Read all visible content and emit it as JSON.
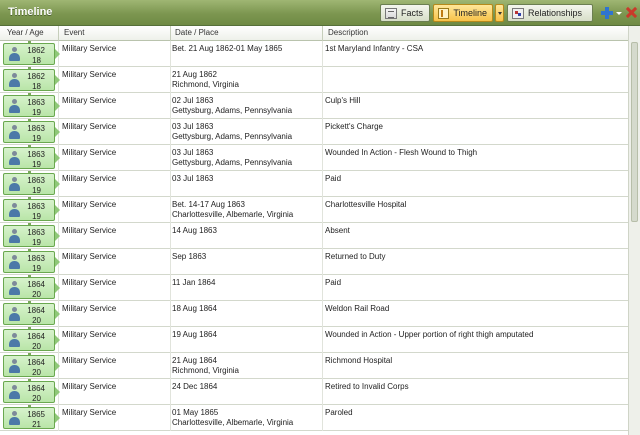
{
  "header": {
    "title": "Timeline",
    "buttons": {
      "facts": "Facts",
      "timeline": "Timeline",
      "relationships": "Relationships"
    }
  },
  "columns": [
    "Year / Age",
    "Event",
    "Date / Place",
    "Description"
  ],
  "rows": [
    {
      "year": "1862",
      "age": "18",
      "event": "Military Service",
      "date": "Bet. 21 Aug 1862-01 May 1865",
      "place": "",
      "description": "1st Maryland Infantry - CSA"
    },
    {
      "year": "1862",
      "age": "18",
      "event": "Military Service",
      "date": "21 Aug 1862",
      "place": "Richmond, Virginia",
      "description": ""
    },
    {
      "year": "1863",
      "age": "19",
      "event": "Military Service",
      "date": "02 Jul 1863",
      "place": "Gettysburg, Adams, Pennsylvania",
      "description": "Culp's Hill"
    },
    {
      "year": "1863",
      "age": "19",
      "event": "Military Service",
      "date": "03 Jul 1863",
      "place": "Gettysburg, Adams, Pennsylvania",
      "description": "Pickett's Charge"
    },
    {
      "year": "1863",
      "age": "19",
      "event": "Military Service",
      "date": "03 Jul 1863",
      "place": "Gettysburg, Adams, Pennsylvania",
      "description": "Wounded In Action - Flesh Wound to Thigh"
    },
    {
      "year": "1863",
      "age": "19",
      "event": "Military Service",
      "date": "03 Jul 1863",
      "place": "",
      "description": "Paid"
    },
    {
      "year": "1863",
      "age": "19",
      "event": "Military Service",
      "date": "Bet. 14-17 Aug 1863",
      "place": "Charlottesville, Albemarle, Virginia",
      "description": "Charlottesville Hospital"
    },
    {
      "year": "1863",
      "age": "19",
      "event": "Military Service",
      "date": "14 Aug 1863",
      "place": "",
      "description": "Absent"
    },
    {
      "year": "1863",
      "age": "19",
      "event": "Military Service",
      "date": "Sep 1863",
      "place": "",
      "description": "Returned to Duty"
    },
    {
      "year": "1864",
      "age": "20",
      "event": "Military Service",
      "date": "11 Jan 1864",
      "place": "",
      "description": "Paid"
    },
    {
      "year": "1864",
      "age": "20",
      "event": "Military Service",
      "date": "18 Aug 1864",
      "place": "",
      "description": "Weldon Rail Road"
    },
    {
      "year": "1864",
      "age": "20",
      "event": "Military Service",
      "date": "19 Aug 1864",
      "place": "",
      "description": "Wounded in Action - Upper portion of right thigh amputated"
    },
    {
      "year": "1864",
      "age": "20",
      "event": "Military Service",
      "date": "21 Aug 1864",
      "place": "Richmond, Virginia",
      "description": "Richmond Hospital"
    },
    {
      "year": "1864",
      "age": "20",
      "event": "Military Service",
      "date": "24 Dec 1864",
      "place": "",
      "description": "Retired to Invalid Corps"
    },
    {
      "year": "1865",
      "age": "21",
      "event": "Military Service",
      "date": "01 May 1865",
      "place": "Charlottesville, Albemarle, Virginia",
      "description": "Paroled"
    }
  ]
}
